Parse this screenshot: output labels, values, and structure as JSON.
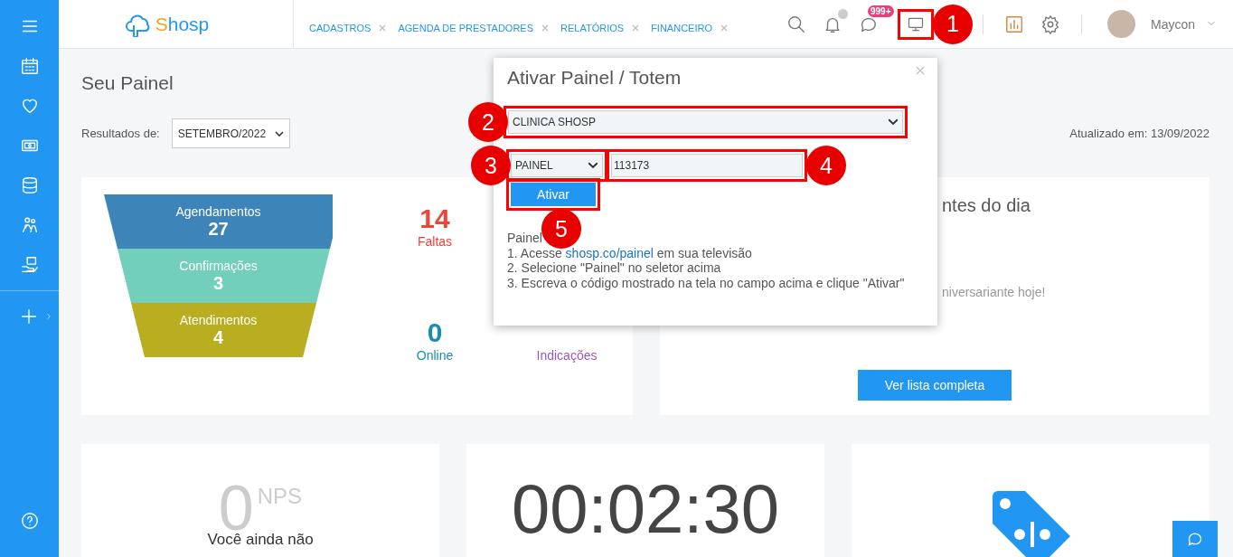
{
  "header": {
    "logo": "Shosp",
    "tabs": [
      {
        "label": "CADASTROS"
      },
      {
        "label": "AGENDA DE PRESTADORES"
      },
      {
        "label": "RELATÓRIOS"
      },
      {
        "label": "FINANCEIRO"
      }
    ],
    "messages_badge": "999+",
    "display_button": {
      "highlighted": true,
      "marker": {
        "label": "1"
      }
    },
    "user": {
      "name": "Maycon"
    }
  },
  "page": {
    "title": "Seu Painel",
    "filter": {
      "label": "Resultados de:",
      "value": "SETEMBRO/2022"
    },
    "updated": "Atualizado em: 13/09/2022"
  },
  "funnel": [
    {
      "label": "Agendamentos",
      "value": "27",
      "color": "#3d84b8"
    },
    {
      "label": "Confirmações",
      "value": "3",
      "color": "#72cfbb"
    },
    {
      "label": "Atendimentos",
      "value": "4",
      "color": "#b9ae20"
    }
  ],
  "stat_columns": [
    {
      "items": [
        {
          "value": "14",
          "label": "Faltas",
          "color": "#f44336"
        },
        {
          "value": "0",
          "label": "Online",
          "color": "#1b8db0"
        }
      ]
    },
    {
      "items": [
        {
          "label": "Indicações",
          "color": "#9b59b6"
        }
      ]
    }
  ],
  "birthdays": {
    "title": "ntes do dia",
    "message": "niversariante hoje!",
    "button": "Ver lista completa"
  },
  "nps": {
    "value": "0",
    "unit": "NPS",
    "message": "Você ainda não"
  },
  "timer": {
    "value": "00:02:30"
  },
  "popup": {
    "title": "Ativar Painel / Totem",
    "unit_select": {
      "value": "CLINICA SHOSP",
      "highlighted": true,
      "marker": {
        "label": "2"
      }
    },
    "type_select": {
      "value": "PAINEL",
      "highlighted": true,
      "marker": {
        "label": "3"
      }
    },
    "code_input": {
      "value": "113173",
      "highlighted": true,
      "marker": {
        "label": "4"
      }
    },
    "activate_button": {
      "label": "Ativar",
      "highlighted": true,
      "marker": {
        "label": "5"
      }
    },
    "instructions": {
      "heading": "Painel",
      "lines": [
        {
          "before": "1. Acesse ",
          "link": "shosp.co/painel",
          "after": " em sua televisão"
        },
        {
          "before": "2. Selecione \"Painel\" no seletor acima"
        },
        {
          "before": "3. Escreva o código mostrado na tela no campo acima e clique \"Ativar\""
        }
      ]
    }
  }
}
